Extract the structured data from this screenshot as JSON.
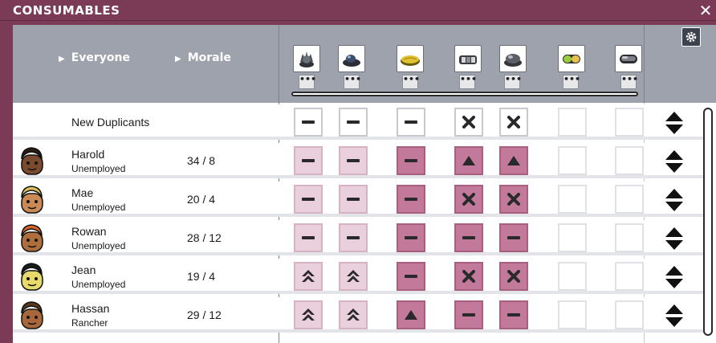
{
  "window": {
    "title": "CONSUMABLES",
    "close_label": "✕"
  },
  "header": {
    "sort_everyone": "Everyone",
    "sort_morale": "Morale",
    "food_items": [
      {
        "icon": "mushroom-icon",
        "more": "•••"
      },
      {
        "icon": "liceloaf-icon",
        "more": "•••"
      },
      {
        "icon": "bread-icon",
        "more": "•••"
      },
      {
        "icon": "meat-icon",
        "more": "•••"
      },
      {
        "icon": "roast-icon",
        "more": "•••"
      },
      {
        "icon": "pill-green-icon",
        "more": "•••"
      },
      {
        "icon": "pill-dark-icon",
        "more": "•••"
      }
    ]
  },
  "new_duplicants": {
    "label": "New Duplicants",
    "cells": [
      "minus",
      "minus",
      "minus",
      "x",
      "x",
      "empty",
      "empty"
    ]
  },
  "duplicants": [
    {
      "name": "Harold",
      "role": "Unemployed",
      "morale": "34 / 8",
      "cells": [
        "light-minus",
        "light-minus",
        "dark-minus",
        "dark-up",
        "dark-up",
        "empty",
        "empty"
      ]
    },
    {
      "name": "Mae",
      "role": "Unemployed",
      "morale": "20 / 4",
      "cells": [
        "light-minus",
        "light-minus",
        "dark-minus",
        "dark-x",
        "dark-x",
        "empty",
        "empty"
      ]
    },
    {
      "name": "Rowan",
      "role": "Unemployed",
      "morale": "28 / 12",
      "cells": [
        "light-minus",
        "light-minus",
        "dark-minus",
        "dark-minus",
        "dark-minus",
        "empty",
        "empty"
      ]
    },
    {
      "name": "Jean",
      "role": "Unemployed",
      "morale": "19 / 4",
      "cells": [
        "light-dblup",
        "light-dblup",
        "dark-minus",
        "dark-x",
        "dark-x",
        "empty",
        "empty"
      ]
    },
    {
      "name": "Hassan",
      "role": "Rancher",
      "morale": "29 / 12",
      "cells": [
        "light-dblup",
        "light-dblup",
        "dark-up",
        "dark-minus",
        "dark-minus",
        "empty",
        "empty"
      ]
    }
  ],
  "colors": {
    "titlebar": "#7b3b57",
    "header": "#9ea2ad",
    "cell_light": "#ead0dc",
    "cell_dark": "#c2799a"
  }
}
